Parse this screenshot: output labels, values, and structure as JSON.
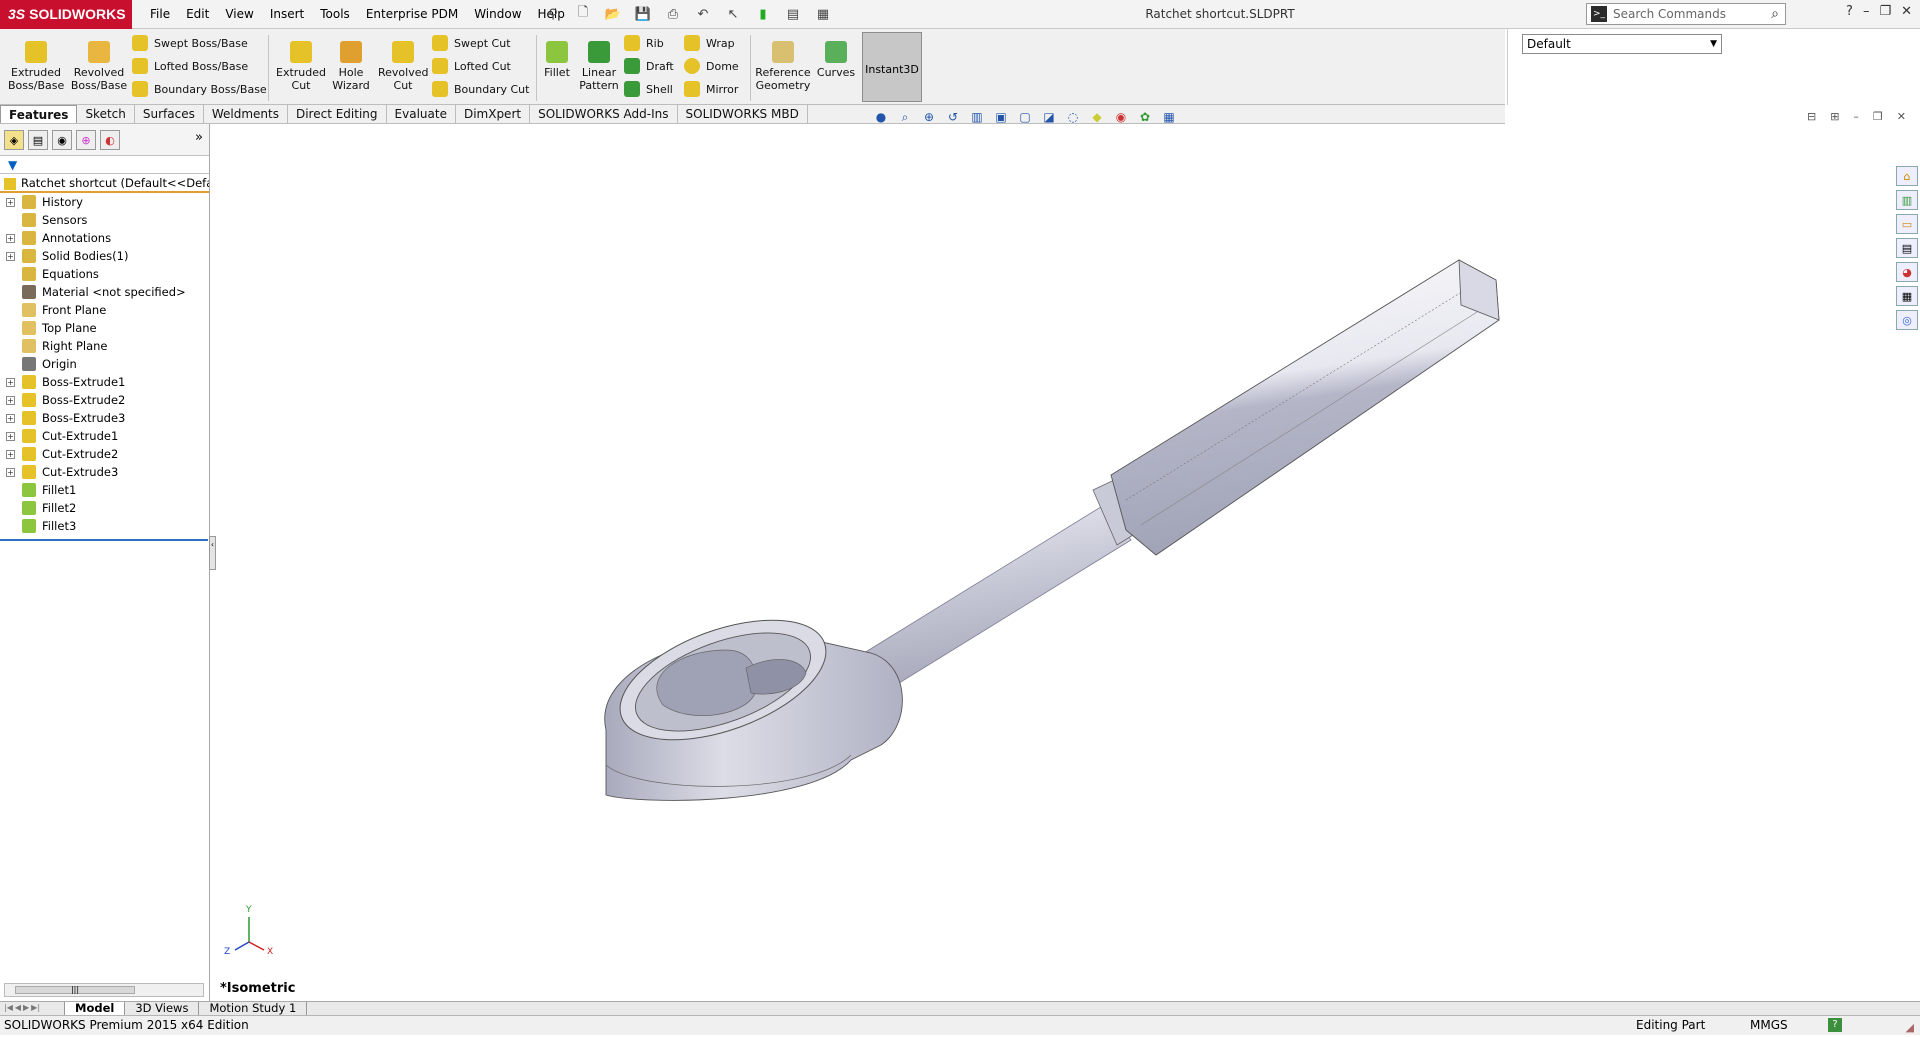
{
  "app": {
    "brand": "SOLIDWORKS",
    "brand_prefix": "3S",
    "doc_title": "Ratchet shortcut.SLDPRT"
  },
  "menu": [
    "File",
    "Edit",
    "View",
    "Insert",
    "Tools",
    "Enterprise PDM",
    "Window",
    "Help"
  ],
  "search": {
    "placeholder": "Search Commands"
  },
  "toolbar": {
    "extruded_boss": "Extruded Boss/Base",
    "revolved_boss": "Revolved Boss/Base",
    "swept_boss": "Swept Boss/Base",
    "lofted_boss": "Lofted Boss/Base",
    "boundary_boss": "Boundary Boss/Base",
    "extruded_cut": "Extruded Cut",
    "hole_wizard": "Hole Wizard",
    "revolved_cut": "Revolved Cut",
    "swept_cut": "Swept Cut",
    "lofted_cut": "Lofted Cut",
    "boundary_cut": "Boundary Cut",
    "fillet": "Fillet",
    "linear_pattern": "Linear Pattern",
    "rib": "Rib",
    "draft": "Draft",
    "shell": "Shell",
    "wrap": "Wrap",
    "dome": "Dome",
    "mirror": "Mirror",
    "reference_geometry": "Reference Geometry",
    "curves": "Curves",
    "instant3d": "Instant3D"
  },
  "configuration": {
    "selected": "Default"
  },
  "command_tabs": [
    "Features",
    "Sketch",
    "Surfaces",
    "Weldments",
    "Direct Editing",
    "Evaluate",
    "DimXpert",
    "SOLIDWORKS Add-Ins",
    "SOLIDWORKS MBD"
  ],
  "feature_tree": {
    "root": "Ratchet shortcut  (Default<<Default",
    "items": [
      {
        "label": "History",
        "expandable": true,
        "color": "#d8b640"
      },
      {
        "label": "Sensors",
        "expandable": false,
        "color": "#d8b640"
      },
      {
        "label": "Annotations",
        "expandable": true,
        "color": "#d8b640"
      },
      {
        "label": "Solid Bodies(1)",
        "expandable": true,
        "color": "#d8b640"
      },
      {
        "label": "Equations",
        "expandable": false,
        "color": "#d8b640"
      },
      {
        "label": "Material <not specified>",
        "expandable": false,
        "color": "#7a6a5a"
      },
      {
        "label": "Front Plane",
        "expandable": false,
        "color": "#e0c060"
      },
      {
        "label": "Top Plane",
        "expandable": false,
        "color": "#e0c060"
      },
      {
        "label": "Right Plane",
        "expandable": false,
        "color": "#e0c060"
      },
      {
        "label": "Origin",
        "expandable": false,
        "color": "#777777"
      },
      {
        "label": "Boss-Extrude1",
        "expandable": true,
        "color": "#e6c229"
      },
      {
        "label": "Boss-Extrude2",
        "expandable": true,
        "color": "#e6c229"
      },
      {
        "label": "Boss-Extrude3",
        "expandable": true,
        "color": "#e6c229"
      },
      {
        "label": "Cut-Extrude1",
        "expandable": true,
        "color": "#e6c229"
      },
      {
        "label": "Cut-Extrude2",
        "expandable": true,
        "color": "#e6c229"
      },
      {
        "label": "Cut-Extrude3",
        "expandable": true,
        "color": "#e6c229"
      },
      {
        "label": "Fillet1",
        "expandable": false,
        "color": "#8cc63f"
      },
      {
        "label": "Fillet2",
        "expandable": false,
        "color": "#8cc63f"
      },
      {
        "label": "Fillet3",
        "expandable": false,
        "color": "#8cc63f"
      }
    ]
  },
  "viewport": {
    "view_name": "*Isometric",
    "triad": {
      "y": "Y",
      "x": "X",
      "z": "Z"
    }
  },
  "bottom_tabs": [
    "Model",
    "3D Views",
    "Motion Study 1"
  ],
  "status": {
    "edition": "SOLIDWORKS Premium 2015 x64 Edition",
    "mode": "Editing Part",
    "units": "MMGS"
  },
  "colors": {
    "brand_red": "#c8102e",
    "tree_underline": "#e0a030",
    "part_gray": "#c9cad6"
  }
}
